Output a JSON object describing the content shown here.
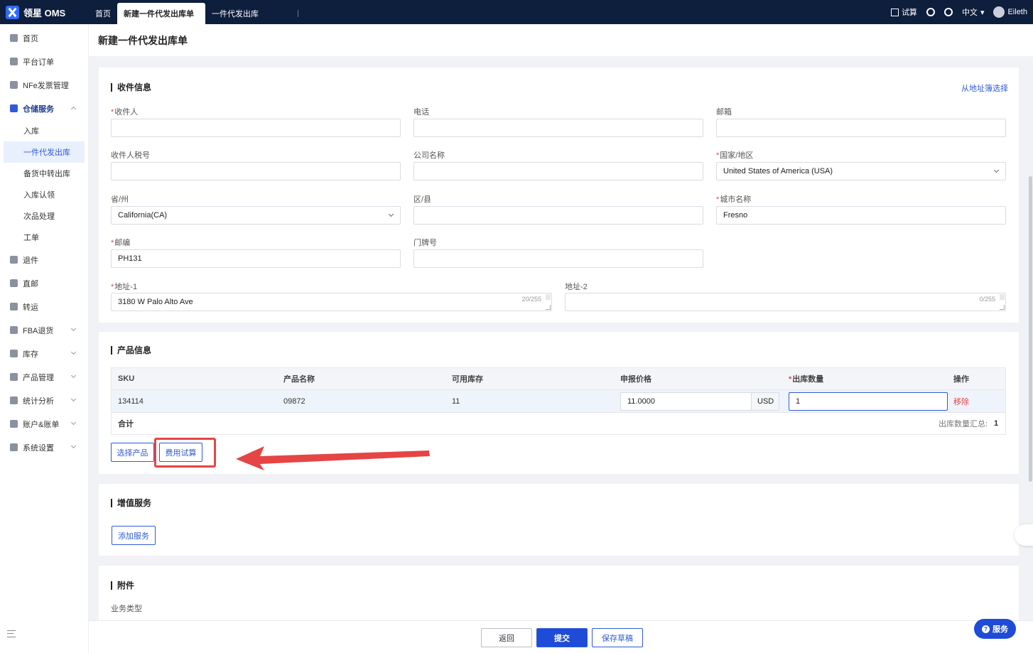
{
  "app": {
    "logo": "领星 OMS"
  },
  "tabs": [
    {
      "label": "首页"
    },
    {
      "label": "新建一件代发出库单"
    },
    {
      "label": "一件代发出库"
    }
  ],
  "topbar": {
    "trial": "试算",
    "lang": "中文",
    "user": "Eileth"
  },
  "sidebar": {
    "items": [
      {
        "label": "首页"
      },
      {
        "label": "平台订单"
      },
      {
        "label": "NFe发票管理"
      },
      {
        "label": "仓储服务"
      },
      {
        "label": "退件"
      },
      {
        "label": "直邮"
      },
      {
        "label": "转运"
      },
      {
        "label": "FBA退货"
      },
      {
        "label": "库存"
      },
      {
        "label": "产品管理"
      },
      {
        "label": "统计分析"
      },
      {
        "label": "账户&账单"
      },
      {
        "label": "系统设置"
      }
    ],
    "sub_items": [
      {
        "label": "入库"
      },
      {
        "label": "一件代发出库"
      },
      {
        "label": "备货中转出库"
      },
      {
        "label": "入库认领"
      },
      {
        "label": "次品处理"
      },
      {
        "label": "工单"
      }
    ]
  },
  "page": {
    "title": "新建一件代发出库单"
  },
  "recipient": {
    "title": "收件信息",
    "address_book_link": "从地址簿选择",
    "name_label": "收件人",
    "phone_label": "电话",
    "email_label": "邮箱",
    "tax_label": "收件人税号",
    "company_label": "公司名称",
    "country_label": "国家/地区",
    "country_value": "United States of America (USA)",
    "state_label": "省/州",
    "state_value": "California(CA)",
    "district_label": "区/县",
    "city_label": "城市名称",
    "city_value": "Fresno",
    "zip_label": "邮编",
    "zip_value": "PH131",
    "house_label": "门牌号",
    "addr1_label": "地址-1",
    "addr1_value": "3180 W Palo Alto Ave",
    "addr1_counter": "20/255",
    "addr2_label": "地址-2",
    "addr2_counter": "0/255"
  },
  "product": {
    "title": "产品信息",
    "columns": {
      "sku": "SKU",
      "name": "产品名称",
      "stock": "可用库存",
      "price": "申报价格",
      "qty": "出库数量",
      "op": "操作"
    },
    "row": {
      "sku": "134114",
      "name": "09872",
      "stock": "11",
      "price": "11.0000",
      "currency": "USD",
      "qty": "1",
      "remove": "移除"
    },
    "total_label": "合计",
    "qty_total_label": "出库数量汇总:",
    "qty_total": "1",
    "select_btn": "选择产品",
    "fee_btn": "费用试算"
  },
  "vas": {
    "title": "增值服务",
    "add_btn": "添加服务"
  },
  "attachment": {
    "title": "附件",
    "biz_type_label": "业务类型"
  },
  "footer": {
    "back": "返回",
    "submit": "提交",
    "draft": "保存草稿",
    "service": "服务"
  },
  "colors": {
    "primary": "#1e4bd8",
    "nav": "#0e1e3d",
    "required": "#e54545",
    "annotation": "#e54545"
  }
}
